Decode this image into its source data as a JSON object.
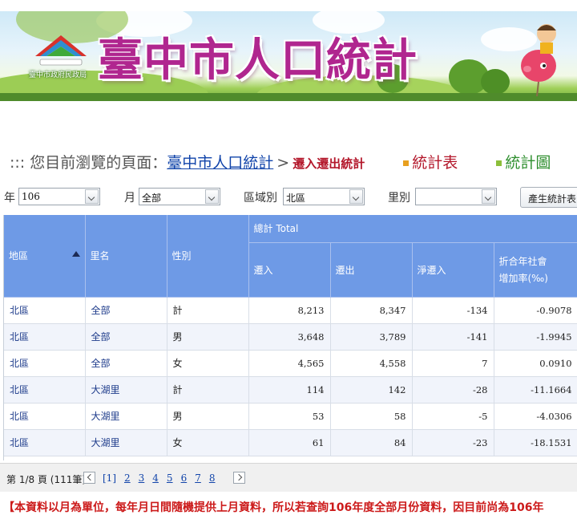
{
  "banner": {
    "title": "臺中市人口統計",
    "agency": "臺中市政府民政局",
    "logo_icon": "taichung-city-logo-icon",
    "mascot_icon": "mascot-icon"
  },
  "breadcrumb": {
    "prefix": "::: 您目前瀏覽的頁面：",
    "home_link": "臺中市人口統計",
    "separator": ">",
    "current": "遷入遷出統計",
    "tab_stats_table": "統計表",
    "tab_stats_chart": "統計圖"
  },
  "filters": {
    "year_label": "年",
    "year_value": "106",
    "month_label": "月",
    "month_value": "全部",
    "district_label": "區域別",
    "district_value": "北區",
    "village_label": "里別",
    "village_value": "",
    "generate_button": "產生統計表"
  },
  "table": {
    "group_header": "總計 Total",
    "columns": {
      "district": "地區",
      "village": "里名",
      "sex": "性別",
      "in": "遷入",
      "out": "遷出",
      "net": "淨遷入",
      "rate_line1": "折合年社會",
      "rate_line2": "增加率(‰)"
    },
    "rows": [
      {
        "district": "北區",
        "village": "全部",
        "sex": "計",
        "in": "8,213",
        "out": "8,347",
        "net": "-134",
        "rate": "-0.9078"
      },
      {
        "district": "北區",
        "village": "全部",
        "sex": "男",
        "in": "3,648",
        "out": "3,789",
        "net": "-141",
        "rate": "-1.9945"
      },
      {
        "district": "北區",
        "village": "全部",
        "sex": "女",
        "in": "4,565",
        "out": "4,558",
        "net": "7",
        "rate": "0.0910"
      },
      {
        "district": "北區",
        "village": "大湖里",
        "sex": "計",
        "in": "114",
        "out": "142",
        "net": "-28",
        "rate": "-11.1664"
      },
      {
        "district": "北區",
        "village": "大湖里",
        "sex": "男",
        "in": "53",
        "out": "58",
        "net": "-5",
        "rate": "-4.0306"
      },
      {
        "district": "北區",
        "village": "大湖里",
        "sex": "女",
        "in": "61",
        "out": "84",
        "net": "-23",
        "rate": "-18.1531"
      }
    ]
  },
  "pager": {
    "info": "第 1/8 頁 (111筆)",
    "pages": [
      "[1]",
      "2",
      "3",
      "4",
      "5",
      "6",
      "7",
      "8"
    ]
  },
  "footer_note": "【本資料以月為單位，每年月日間隨機提供上月資料，所以若查詢106年度全部月份資料，因目前尚為106年"
}
